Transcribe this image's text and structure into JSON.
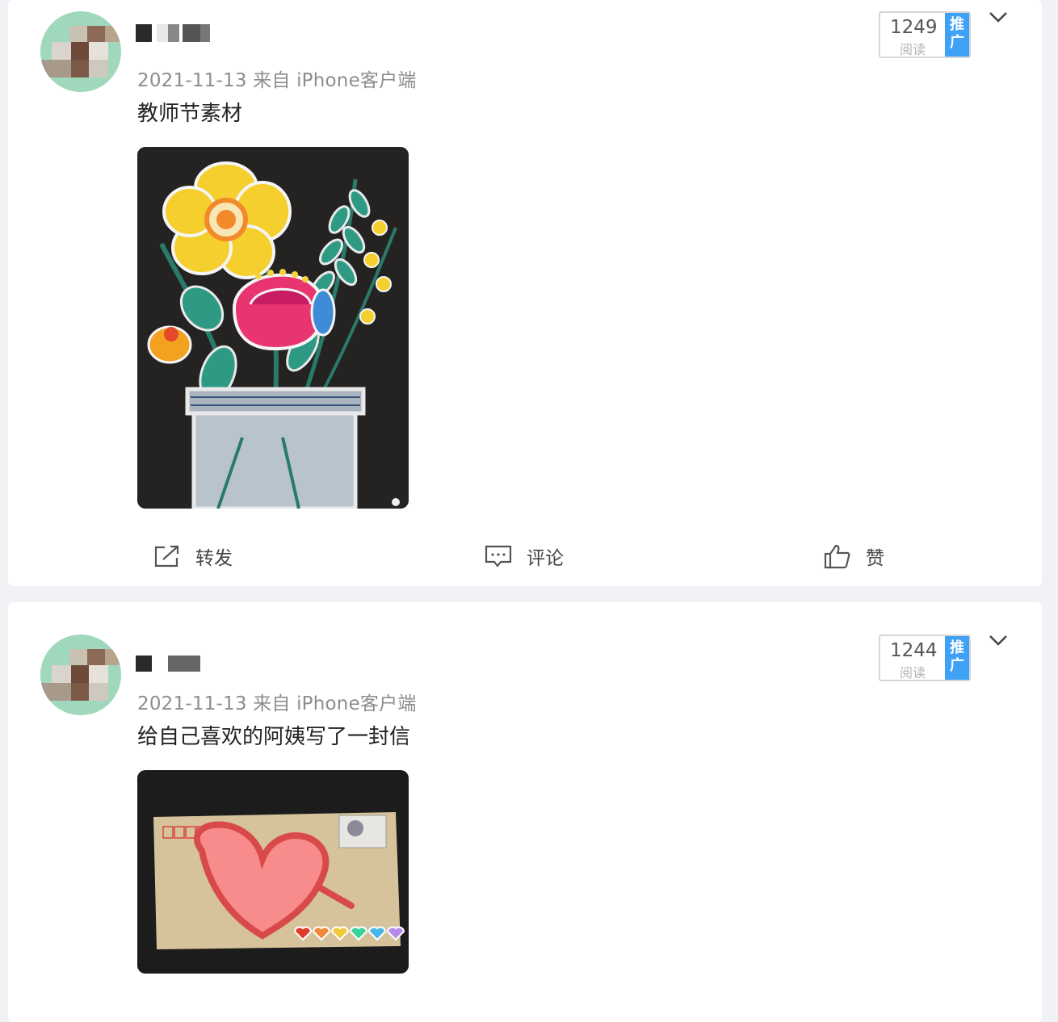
{
  "posts": [
    {
      "date_source": "2021-11-13 来自 iPhone客户端",
      "content": "教师节素材",
      "reads": "1249",
      "reads_label": "阅读",
      "promo_label": "推广",
      "actions": {
        "repost": "转发",
        "comment": "评论",
        "like": "赞"
      }
    },
    {
      "date_source": "2021-11-13 来自 iPhone客户端",
      "content": "给自己喜欢的阿姨写了一封信",
      "reads": "1244",
      "reads_label": "阅读",
      "promo_label": "推广"
    }
  ],
  "icons": {
    "repost": "share-arrow-icon",
    "comment": "comment-bubble-icon",
    "like": "thumbs-up-icon",
    "menu": "chevron-down-icon"
  },
  "colors": {
    "promo_blue": "#3ea1f6",
    "card_bg": "#ffffff",
    "page_bg": "#f1f2f5"
  }
}
